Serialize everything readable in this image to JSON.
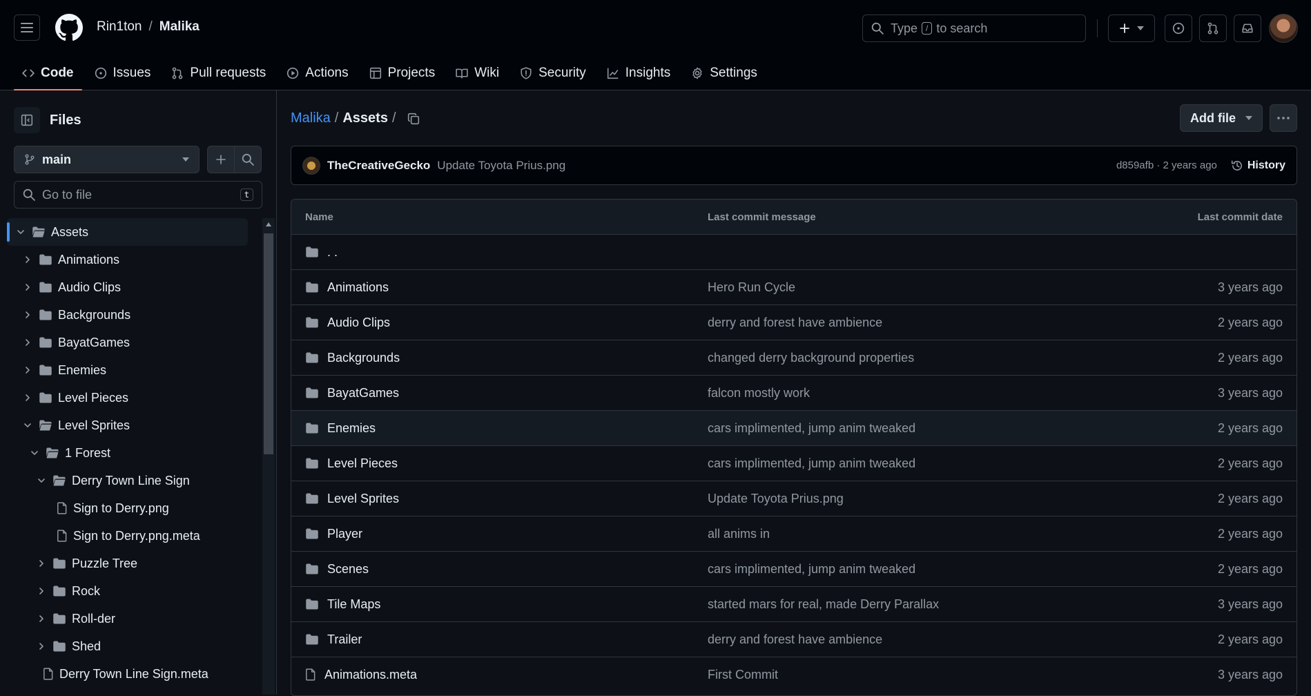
{
  "header": {
    "owner": "Rin1ton",
    "separator": "/",
    "repo": "Malika",
    "search_placeholder_pre": "Type",
    "search_key": "/",
    "search_placeholder_post": "to search"
  },
  "nav": {
    "tabs": [
      {
        "label": "Code",
        "icon": "code-icon",
        "active": true
      },
      {
        "label": "Issues",
        "icon": "issue-icon"
      },
      {
        "label": "Pull requests",
        "icon": "pull-request-icon"
      },
      {
        "label": "Actions",
        "icon": "play-icon"
      },
      {
        "label": "Projects",
        "icon": "table-icon"
      },
      {
        "label": "Wiki",
        "icon": "book-icon"
      },
      {
        "label": "Security",
        "icon": "shield-icon"
      },
      {
        "label": "Insights",
        "icon": "graph-icon"
      },
      {
        "label": "Settings",
        "icon": "gear-icon"
      }
    ]
  },
  "sidebar": {
    "title": "Files",
    "branch": "main",
    "goto_placeholder": "Go to file",
    "goto_key": "t",
    "tree": [
      {
        "label": "Assets",
        "type": "folder",
        "open": true,
        "depth": 0,
        "selected": true
      },
      {
        "label": "Animations",
        "type": "folder",
        "open": false,
        "depth": 1
      },
      {
        "label": "Audio Clips",
        "type": "folder",
        "open": false,
        "depth": 1
      },
      {
        "label": "Backgrounds",
        "type": "folder",
        "open": false,
        "depth": 1
      },
      {
        "label": "BayatGames",
        "type": "folder",
        "open": false,
        "depth": 1
      },
      {
        "label": "Enemies",
        "type": "folder",
        "open": false,
        "depth": 1
      },
      {
        "label": "Level Pieces",
        "type": "folder",
        "open": false,
        "depth": 1
      },
      {
        "label": "Level Sprites",
        "type": "folder",
        "open": true,
        "depth": 1
      },
      {
        "label": "1 Forest",
        "type": "folder",
        "open": true,
        "depth": 2
      },
      {
        "label": "Derry Town Line Sign",
        "type": "folder",
        "open": true,
        "depth": 3
      },
      {
        "label": "Sign to Derry.png",
        "type": "file",
        "depth": 4
      },
      {
        "label": "Sign to Derry.png.meta",
        "type": "file",
        "depth": 4
      },
      {
        "label": "Puzzle Tree",
        "type": "folder",
        "open": false,
        "depth": 3
      },
      {
        "label": "Rock",
        "type": "folder",
        "open": false,
        "depth": 3
      },
      {
        "label": "Roll-der",
        "type": "folder",
        "open": false,
        "depth": 3
      },
      {
        "label": "Shed",
        "type": "folder",
        "open": false,
        "depth": 3
      },
      {
        "label": "Derry Town Line Sign.meta",
        "type": "file",
        "depth": 3
      }
    ]
  },
  "main": {
    "path_repo": "Malika",
    "path_sep": "/",
    "path_current": "Assets",
    "add_file": "Add file",
    "commit": {
      "author": "TheCreativeGecko",
      "message": "Update Toyota Prius.png",
      "meta": "d859afb · 2 years ago",
      "history": "History"
    },
    "columns": {
      "name": "Name",
      "message": "Last commit message",
      "date": "Last commit date"
    },
    "parent": ". .",
    "rows": [
      {
        "name": "Animations",
        "type": "folder",
        "message": "Hero Run Cycle",
        "date": "3 years ago"
      },
      {
        "name": "Audio Clips",
        "type": "folder",
        "message": "derry and forest have ambience",
        "date": "2 years ago"
      },
      {
        "name": "Backgrounds",
        "type": "folder",
        "message": "changed derry background properties",
        "date": "2 years ago"
      },
      {
        "name": "BayatGames",
        "type": "folder",
        "message": "falcon mostly work",
        "date": "3 years ago"
      },
      {
        "name": "Enemies",
        "type": "folder",
        "message": "cars implimented, jump anim tweaked",
        "date": "2 years ago",
        "hover": true
      },
      {
        "name": "Level Pieces",
        "type": "folder",
        "message": "cars implimented, jump anim tweaked",
        "date": "2 years ago"
      },
      {
        "name": "Level Sprites",
        "type": "folder",
        "message": "Update Toyota Prius.png",
        "date": "2 years ago"
      },
      {
        "name": "Player",
        "type": "folder",
        "message": "all anims in",
        "date": "2 years ago"
      },
      {
        "name": "Scenes",
        "type": "folder",
        "message": "cars implimented, jump anim tweaked",
        "date": "2 years ago"
      },
      {
        "name": "Tile Maps",
        "type": "folder",
        "message": "started mars for real, made Derry Parallax",
        "date": "3 years ago"
      },
      {
        "name": "Trailer",
        "type": "folder",
        "message": "derry and forest have ambience",
        "date": "2 years ago"
      },
      {
        "name": "Animations.meta",
        "type": "file",
        "message": "First Commit",
        "date": "3 years ago"
      }
    ]
  }
}
